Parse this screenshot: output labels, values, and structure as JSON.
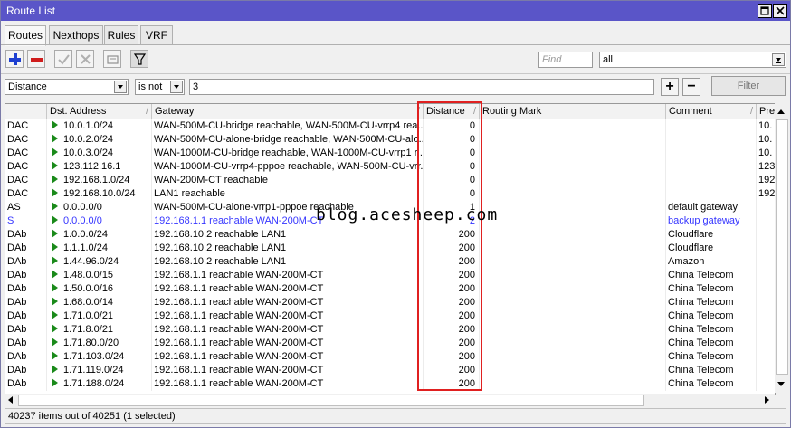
{
  "window": {
    "title": "Route List"
  },
  "tabs": [
    "Routes",
    "Nexthops",
    "Rules",
    "VRF"
  ],
  "toolbar": {
    "find_placeholder": "Find",
    "scope_value": "all"
  },
  "filter": {
    "field": "Distance",
    "operator": "is not",
    "value": "3",
    "filter_button": "Filter"
  },
  "columns": [
    "Dst. Address",
    "Gateway",
    "Distance",
    "Routing Mark",
    "Comment",
    "Pre"
  ],
  "rows": [
    {
      "flags": "DAC",
      "dst": "10.0.1.0/24",
      "gw": "WAN-500M-CU-bridge reachable, WAN-500M-CU-vrrp4 rea...",
      "dist": "0",
      "mark": "",
      "comment": "",
      "pref": "10.",
      "color": "normal"
    },
    {
      "flags": "DAC",
      "dst": "10.0.2.0/24",
      "gw": "WAN-500M-CU-alone-bridge reachable, WAN-500M-CU-alo...",
      "dist": "0",
      "mark": "",
      "comment": "",
      "pref": "10.",
      "color": "normal"
    },
    {
      "flags": "DAC",
      "dst": "10.0.3.0/24",
      "gw": "WAN-1000M-CU-bridge reachable, WAN-1000M-CU-vrrp1 r...",
      "dist": "0",
      "mark": "",
      "comment": "",
      "pref": "10.",
      "color": "normal"
    },
    {
      "flags": "DAC",
      "dst": "123.112.16.1",
      "gw": "WAN-1000M-CU-vrrp4-pppoe reachable, WAN-500M-CU-vrr...",
      "dist": "0",
      "mark": "",
      "comment": "",
      "pref": "123",
      "color": "normal"
    },
    {
      "flags": "DAC",
      "dst": "192.168.1.0/24",
      "gw": "WAN-200M-CT reachable",
      "dist": "0",
      "mark": "",
      "comment": "",
      "pref": "192",
      "color": "normal"
    },
    {
      "flags": "DAC",
      "dst": "192.168.10.0/24",
      "gw": "LAN1 reachable",
      "dist": "0",
      "mark": "",
      "comment": "",
      "pref": "192",
      "color": "normal"
    },
    {
      "flags": "AS",
      "dst": "0.0.0.0/0",
      "gw": "WAN-500M-CU-alone-vrrp1-pppoe reachable",
      "dist": "1",
      "mark": "",
      "comment": "default gateway",
      "pref": "",
      "color": "normal"
    },
    {
      "flags": "S",
      "dst": "0.0.0.0/0",
      "gw": "192.168.1.1 reachable WAN-200M-CT",
      "dist": "2",
      "mark": "",
      "comment": "backup gateway",
      "pref": "",
      "color": "blue"
    },
    {
      "flags": "DAb",
      "dst": "1.0.0.0/24",
      "gw": "192.168.10.2 reachable LAN1",
      "dist": "200",
      "mark": "",
      "comment": "Cloudflare",
      "pref": "",
      "color": "normal"
    },
    {
      "flags": "DAb",
      "dst": "1.1.1.0/24",
      "gw": "192.168.10.2 reachable LAN1",
      "dist": "200",
      "mark": "",
      "comment": "Cloudflare",
      "pref": "",
      "color": "normal"
    },
    {
      "flags": "DAb",
      "dst": "1.44.96.0/24",
      "gw": "192.168.10.2 reachable LAN1",
      "dist": "200",
      "mark": "",
      "comment": "Amazon",
      "pref": "",
      "color": "normal"
    },
    {
      "flags": "DAb",
      "dst": "1.48.0.0/15",
      "gw": "192.168.1.1 reachable WAN-200M-CT",
      "dist": "200",
      "mark": "",
      "comment": "China Telecom",
      "pref": "",
      "color": "normal"
    },
    {
      "flags": "DAb",
      "dst": "1.50.0.0/16",
      "gw": "192.168.1.1 reachable WAN-200M-CT",
      "dist": "200",
      "mark": "",
      "comment": "China Telecom",
      "pref": "",
      "color": "normal"
    },
    {
      "flags": "DAb",
      "dst": "1.68.0.0/14",
      "gw": "192.168.1.1 reachable WAN-200M-CT",
      "dist": "200",
      "mark": "",
      "comment": "China Telecom",
      "pref": "",
      "color": "normal"
    },
    {
      "flags": "DAb",
      "dst": "1.71.0.0/21",
      "gw": "192.168.1.1 reachable WAN-200M-CT",
      "dist": "200",
      "mark": "",
      "comment": "China Telecom",
      "pref": "",
      "color": "normal"
    },
    {
      "flags": "DAb",
      "dst": "1.71.8.0/21",
      "gw": "192.168.1.1 reachable WAN-200M-CT",
      "dist": "200",
      "mark": "",
      "comment": "China Telecom",
      "pref": "",
      "color": "normal"
    },
    {
      "flags": "DAb",
      "dst": "1.71.80.0/20",
      "gw": "192.168.1.1 reachable WAN-200M-CT",
      "dist": "200",
      "mark": "",
      "comment": "China Telecom",
      "pref": "",
      "color": "normal"
    },
    {
      "flags": "DAb",
      "dst": "1.71.103.0/24",
      "gw": "192.168.1.1 reachable WAN-200M-CT",
      "dist": "200",
      "mark": "",
      "comment": "China Telecom",
      "pref": "",
      "color": "normal"
    },
    {
      "flags": "DAb",
      "dst": "1.71.119.0/24",
      "gw": "192.168.1.1 reachable WAN-200M-CT",
      "dist": "200",
      "mark": "",
      "comment": "China Telecom",
      "pref": "",
      "color": "normal"
    },
    {
      "flags": "DAb",
      "dst": "1.71.188.0/24",
      "gw": "192.168.1.1 reachable WAN-200M-CT",
      "dist": "200",
      "mark": "",
      "comment": "China Telecom",
      "pref": "",
      "color": "normal"
    }
  ],
  "status": "40237 items out of 40251 (1 selected)",
  "watermark": "blog.acesheep.com",
  "colors": {
    "titlebar": "#5a55c8",
    "highlight_box": "#e02020",
    "link_row": "#3535ff",
    "status_arrow": "#1a8a1a"
  }
}
